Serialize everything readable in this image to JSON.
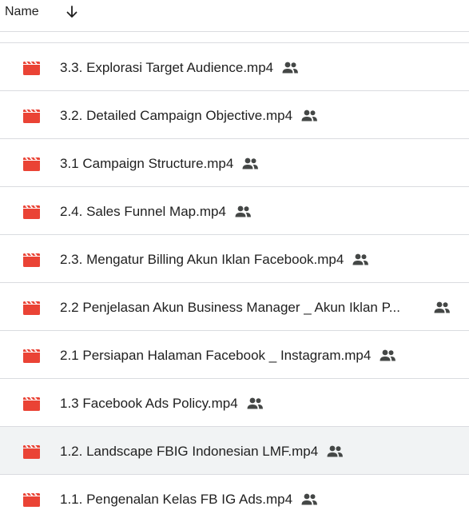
{
  "header": {
    "name_label": "Name",
    "sort_icon": "arrow-down-icon"
  },
  "files": [
    {
      "name": "3.3. Explorasi Target Audience.mp4",
      "icon": "video-file-icon",
      "shared": true,
      "selected": false
    },
    {
      "name": "3.2. Detailed Campaign Objective.mp4",
      "icon": "video-file-icon",
      "shared": true,
      "selected": false
    },
    {
      "name": "3.1 Campaign Structure.mp4",
      "icon": "video-file-icon",
      "shared": true,
      "selected": false
    },
    {
      "name": "2.4. Sales Funnel Map.mp4",
      "icon": "video-file-icon",
      "shared": true,
      "selected": false
    },
    {
      "name": "2.3. Mengatur Billing Akun Iklan Facebook.mp4",
      "icon": "video-file-icon",
      "shared": true,
      "selected": false
    },
    {
      "name": "2.2 Penjelasan Akun Business Manager _ Akun Iklan P...",
      "icon": "video-file-icon",
      "shared": true,
      "selected": false
    },
    {
      "name": "2.1 Persiapan Halaman Facebook _ Instagram.mp4",
      "icon": "video-file-icon",
      "shared": true,
      "selected": false
    },
    {
      "name": "1.3 Facebook Ads Policy.mp4",
      "icon": "video-file-icon",
      "shared": true,
      "selected": false
    },
    {
      "name": "1.2. Landscape FBIG Indonesian LMF.mp4",
      "icon": "video-file-icon",
      "shared": true,
      "selected": true
    },
    {
      "name": "1.1. Pengenalan Kelas FB IG Ads.mp4",
      "icon": "video-file-icon",
      "shared": true,
      "selected": false
    }
  ],
  "colors": {
    "video_icon": "#ea4335",
    "shared_icon": "#444746",
    "divider": "#dadce0",
    "selected_row": "#f1f3f4"
  }
}
